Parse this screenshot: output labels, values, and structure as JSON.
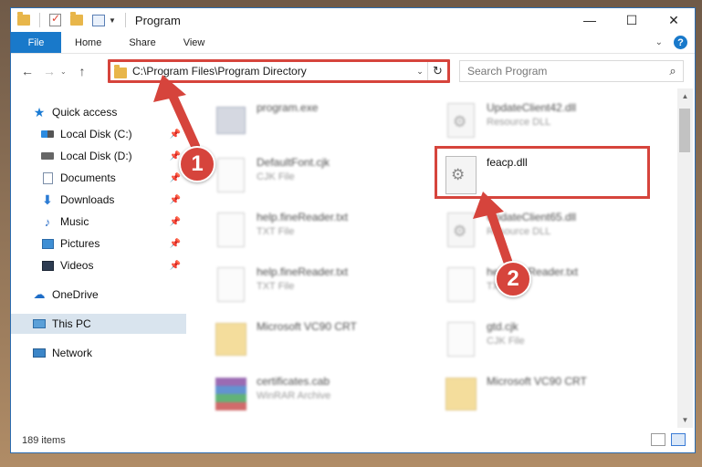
{
  "window": {
    "title": "Program",
    "controls": {
      "minimize": "—",
      "maximize": "☐",
      "close": "✕"
    }
  },
  "ribbon": {
    "tabs": [
      "File",
      "Home",
      "Share",
      "View"
    ]
  },
  "address": {
    "path": "C:\\Program Files\\Program Directory"
  },
  "search": {
    "placeholder": "Search Program"
  },
  "nav": {
    "items": [
      {
        "label": "Quick access",
        "icon": "star-icon"
      },
      {
        "label": "Local Disk (C:)",
        "icon": "disk-icon",
        "pinned": true
      },
      {
        "label": "Local Disk (D:)",
        "icon": "disk-icon",
        "pinned": true
      },
      {
        "label": "Documents",
        "icon": "document-icon",
        "pinned": true
      },
      {
        "label": "Downloads",
        "icon": "download-icon",
        "pinned": true
      },
      {
        "label": "Music",
        "icon": "music-icon",
        "pinned": true
      },
      {
        "label": "Pictures",
        "icon": "pictures-icon",
        "pinned": true
      },
      {
        "label": "Videos",
        "icon": "videos-icon",
        "pinned": true
      },
      {
        "label": "OneDrive",
        "icon": "cloud-icon"
      },
      {
        "label": "This PC",
        "icon": "computer-icon",
        "selected": true
      },
      {
        "label": "Network",
        "icon": "network-icon"
      }
    ]
  },
  "files": {
    "left": [
      {
        "name": "program.exe",
        "type": "",
        "icon": "exe"
      },
      {
        "name": "DefaultFont.cjk",
        "type": "CJK File",
        "icon": "page"
      },
      {
        "name": "help.fineReader.txt",
        "type": "TXT File",
        "icon": "page"
      },
      {
        "name": "help.fineReader.txt",
        "type": "TXT File",
        "icon": "page"
      },
      {
        "name": "Microsoft VC90 CRT",
        "type": "",
        "icon": "folder"
      },
      {
        "name": "certificates.cab",
        "type": "WinRAR Archive",
        "icon": "rar"
      }
    ],
    "right": [
      {
        "name": "UpdateClient42.dll",
        "type": "Resource DLL",
        "icon": "dll"
      },
      {
        "name": "feacp.dll",
        "type": "",
        "icon": "dll",
        "highlight": true
      },
      {
        "name": "UpdateClient65.dll",
        "type": "Resource DLL",
        "icon": "dll"
      },
      {
        "name": "help.fineReader.txt",
        "type": "TXT File",
        "icon": "page"
      },
      {
        "name": "gtd.cjk",
        "type": "CJK File",
        "icon": "page"
      },
      {
        "name": "Microsoft VC90 CRT",
        "type": "",
        "icon": "folder"
      }
    ]
  },
  "status": {
    "count": "189 items"
  },
  "annotations": {
    "badge1": "1",
    "badge2": "2",
    "color": "#d6443c"
  }
}
